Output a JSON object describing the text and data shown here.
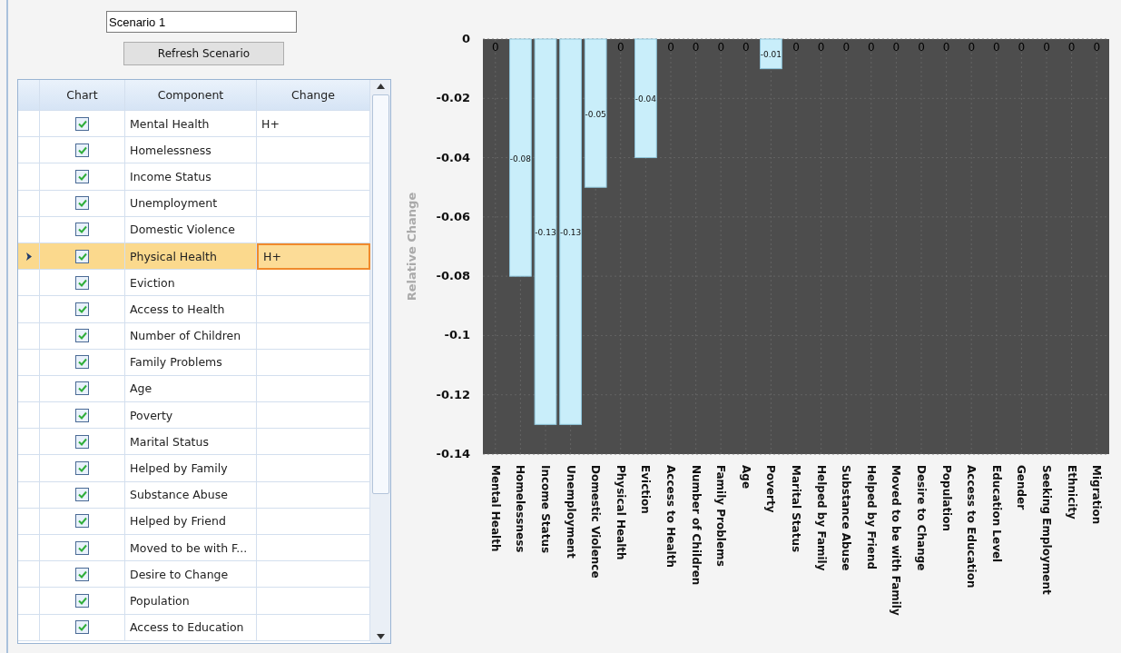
{
  "scenario": {
    "name_value": "Scenario 1",
    "refresh_button": "Refresh Scenario"
  },
  "grid": {
    "columns": [
      "Chart",
      "Component",
      "Change"
    ],
    "rows": [
      {
        "chart": true,
        "component": "Mental Health",
        "change": "H+",
        "selected": false
      },
      {
        "chart": true,
        "component": "Homelessness",
        "change": "",
        "selected": false
      },
      {
        "chart": true,
        "component": "Income Status",
        "change": "",
        "selected": false
      },
      {
        "chart": true,
        "component": "Unemployment",
        "change": "",
        "selected": false
      },
      {
        "chart": true,
        "component": "Domestic Violence",
        "change": "",
        "selected": false
      },
      {
        "chart": true,
        "component": "Physical Health",
        "change": "H+",
        "selected": true
      },
      {
        "chart": true,
        "component": "Eviction",
        "change": "",
        "selected": false
      },
      {
        "chart": true,
        "component": "Access to Health",
        "change": "",
        "selected": false
      },
      {
        "chart": true,
        "component": "Number of Children",
        "change": "",
        "selected": false
      },
      {
        "chart": true,
        "component": "Family  Problems",
        "change": "",
        "selected": false
      },
      {
        "chart": true,
        "component": "Age",
        "change": "",
        "selected": false
      },
      {
        "chart": true,
        "component": "Poverty",
        "change": "",
        "selected": false
      },
      {
        "chart": true,
        "component": "Marital Status",
        "change": "",
        "selected": false
      },
      {
        "chart": true,
        "component": "Helped by Family",
        "change": "",
        "selected": false
      },
      {
        "chart": true,
        "component": "Substance Abuse",
        "change": "",
        "selected": false
      },
      {
        "chart": true,
        "component": "Helped by Friend",
        "change": "",
        "selected": false
      },
      {
        "chart": true,
        "component": "Moved to be with F...",
        "change": "",
        "selected": false
      },
      {
        "chart": true,
        "component": "Desire to Change",
        "change": "",
        "selected": false
      },
      {
        "chart": true,
        "component": "Population",
        "change": "",
        "selected": false
      },
      {
        "chart": true,
        "component": "Access to Education",
        "change": "",
        "selected": false
      }
    ]
  },
  "chart": {
    "chart_data": {
      "type": "bar",
      "ylabel": "Relative Change",
      "categories": [
        "Mental Health",
        "Homelessness",
        "Income Status",
        "Unemployment",
        "Domestic Violence",
        "Physical Health",
        "Eviction",
        "Access to Health",
        "Number of Children",
        "Family  Problems",
        "Age",
        "Poverty",
        "Marital Status",
        "Helped by Family",
        "Substance Abuse",
        "Helped by Friend",
        "Moved to be with Family",
        "Desire to Change",
        "Population",
        "Access to Education",
        "Education Level",
        "Gender",
        "Seeking Employment",
        "Ethnicity",
        "Migration"
      ],
      "grid": true,
      "series": [
        {
          "color": "#c9eefa",
          "values": [
            0,
            -0.08,
            -0.13,
            -0.13,
            -0.05,
            0,
            -0.04,
            0,
            0,
            0,
            0,
            -0.01,
            0,
            0,
            0,
            0,
            0,
            0,
            0,
            0,
            0,
            0,
            0,
            0,
            0
          ]
        }
      ],
      "value_labels": [
        "0",
        "-0.08",
        "-0.13",
        "-0.13",
        "-0.05",
        "0",
        "-0.04",
        "0",
        "0",
        "0",
        "0",
        "-0.01",
        "0",
        "0",
        "0",
        "0",
        "0",
        "0",
        "0",
        "0",
        "0",
        "0",
        "0",
        "0",
        "0"
      ],
      "ylim": [
        -0.14,
        0
      ],
      "yticks": [
        0,
        -0.02,
        -0.04,
        -0.06,
        {
          "value": -0.08,
          "label": "-0.08"
        },
        {
          "value": -0.1,
          "label": "-0.1"
        },
        -0.12,
        -0.14
      ]
    }
  }
}
